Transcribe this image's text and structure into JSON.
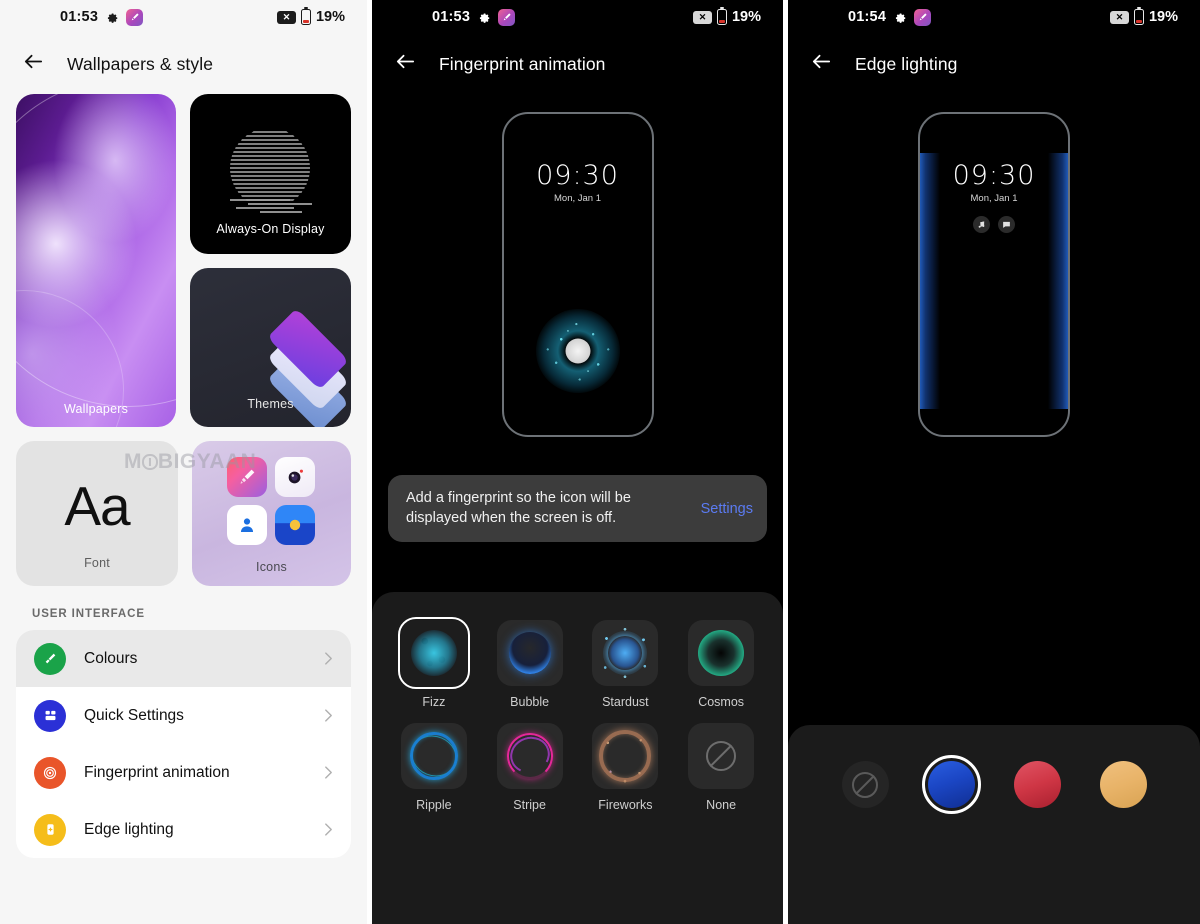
{
  "watermark": {
    "pre": "M",
    "post": "BIGYAAN"
  },
  "panels": {
    "left": {
      "status": {
        "time": "01:53",
        "battery_pct": "19%",
        "nosim_glyph": "✕"
      },
      "appbar": {
        "title": "Wallpapers & style",
        "back_label": "Back"
      },
      "cards": [
        {
          "name": "wallpapers",
          "label": "Wallpapers"
        },
        {
          "name": "always-on-display",
          "label": "Always-On Display"
        },
        {
          "name": "themes",
          "label": "Themes"
        },
        {
          "name": "font",
          "label": "Font",
          "sample": "Aa"
        },
        {
          "name": "icons",
          "label": "Icons"
        }
      ],
      "section_header": "USER INTERFACE",
      "list": [
        {
          "label": "Colours",
          "icon": "paint-roller-icon",
          "color": "#1aa349",
          "selected": true
        },
        {
          "label": "Quick Settings",
          "icon": "quick-settings-icon",
          "color": "#2b30d6",
          "selected": false
        },
        {
          "label": "Fingerprint animation",
          "icon": "fingerprint-icon",
          "color": "#e9552a",
          "selected": false
        },
        {
          "label": "Edge lighting",
          "icon": "edge-lighting-icon",
          "color": "#f5bd1a",
          "selected": false
        }
      ]
    },
    "middle": {
      "status": {
        "time": "01:53",
        "battery_pct": "19%",
        "nosim_glyph": "✕"
      },
      "appbar": {
        "title": "Fingerprint animation",
        "back_label": "Back"
      },
      "preview": {
        "clock": "09:30",
        "date": "Mon, Jan 1"
      },
      "banner": {
        "message": "Add a fingerprint so the icon will be displayed when the screen is off.",
        "action": "Settings",
        "action_color": "#5b7bf2"
      },
      "styles": [
        {
          "label": "Fizz",
          "selected": true
        },
        {
          "label": "Bubble",
          "selected": false
        },
        {
          "label": "Stardust",
          "selected": false
        },
        {
          "label": "Cosmos",
          "selected": false
        },
        {
          "label": "Ripple",
          "selected": false
        },
        {
          "label": "Stripe",
          "selected": false
        },
        {
          "label": "Fireworks",
          "selected": false
        },
        {
          "label": "None",
          "selected": false
        }
      ]
    },
    "right": {
      "status": {
        "time": "01:54",
        "battery_pct": "19%",
        "nosim_glyph": "✕"
      },
      "appbar": {
        "title": "Edge lighting",
        "back_label": "Back"
      },
      "preview": {
        "clock": "09:30",
        "date": "Mon, Jan 1"
      },
      "colors": [
        {
          "name": "none",
          "hex": "#252525",
          "selected": false
        },
        {
          "name": "blue",
          "hex": "#1b46c4",
          "selected": true
        },
        {
          "name": "red",
          "hex": "#cf3645",
          "selected": false
        },
        {
          "name": "amber",
          "hex": "#e8b368",
          "selected": false
        }
      ]
    }
  }
}
